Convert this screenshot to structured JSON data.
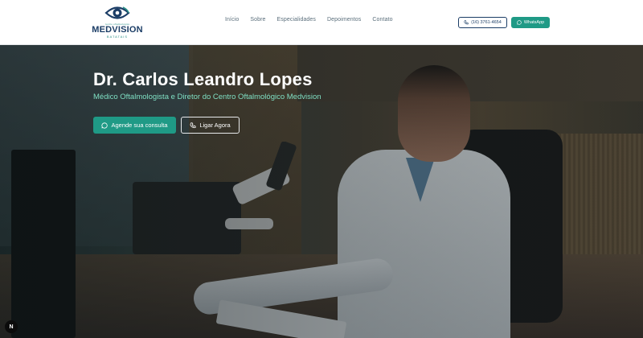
{
  "header": {
    "logo": {
      "small_text": "centro oftalmológico",
      "name": "MEDVISION",
      "sub": "BATATAIS"
    },
    "nav": [
      "Início",
      "Sobre",
      "Especialidades",
      "Depoimentos",
      "Contato"
    ],
    "phone_label": "(16) 3761-4654",
    "whatsapp_label": "WhatsApp"
  },
  "hero": {
    "title": "Dr. Carlos Leandro Lopes",
    "subtitle": "Médico Oftalmologista e Diretor do Centro Oftalmológico Medvision",
    "cta_primary": "Agende sua consulta",
    "cta_secondary": "Ligar Agora"
  },
  "badge": "N",
  "colors": {
    "brand_navy": "#1b3d66",
    "brand_teal": "#1f9a86",
    "accent_text": "#7fe0c4"
  },
  "icons": {
    "logo": "eye-logo-icon",
    "phone": "phone-icon",
    "whatsapp": "chat-bubble-icon"
  }
}
